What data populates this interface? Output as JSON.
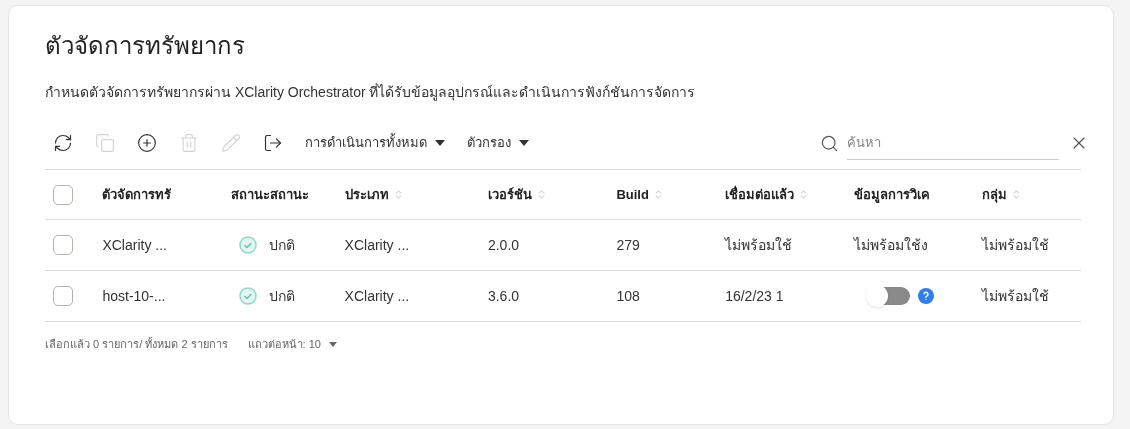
{
  "title": "ตัวจัดการทรัพยากร",
  "description": "กำหนดตัวจัดการทรัพยากรผ่าน XClarity Orchestrator ที่ได้รับข้อมูลอุปกรณ์และดำเนินการฟังก์ชันการจัดการ",
  "toolbar": {
    "icons": [
      {
        "kind": "refresh",
        "disabled": false
      },
      {
        "kind": "copy",
        "disabled": true
      },
      {
        "kind": "add",
        "disabled": false
      },
      {
        "kind": "delete",
        "disabled": true
      },
      {
        "kind": "edit",
        "disabled": true
      },
      {
        "kind": "export",
        "disabled": false
      }
    ],
    "menus": [
      "การดำเนินการทั้งหมด",
      "ตัวกรอง"
    ],
    "search": {
      "placeholder": "ค้นหา"
    }
  },
  "table": {
    "select_all": {
      "checked": false
    },
    "columns": [
      {
        "label": "ตัวจัดการทรั",
        "sortable": false
      },
      {
        "label": "สถานะสถานะ",
        "sortable": false
      },
      {
        "label": "ประเภท",
        "sortable": true
      },
      {
        "label": "เวอร์ชัน",
        "sortable": true
      },
      {
        "label": "Build",
        "sortable": true
      },
      {
        "label": "เชื่อมต่อแล้ว",
        "sortable": true
      },
      {
        "label": "ข้อมูลการวิเค",
        "sortable": false
      },
      {
        "label": "กลุ่ม",
        "sortable": true
      }
    ],
    "rows": [
      {
        "checked": false,
        "cells": [
          {
            "kind": "text",
            "text": "XClarity ..."
          },
          {
            "kind": "status",
            "text": "ปกติ"
          },
          {
            "kind": "text",
            "text": "XClarity ..."
          },
          {
            "kind": "text",
            "text": "2.0.0"
          },
          {
            "kind": "text",
            "text": "279"
          },
          {
            "kind": "text",
            "text": "ไม่พร้อมใช้"
          },
          {
            "kind": "text",
            "text": "ไม่พร้อมใช้ง"
          },
          {
            "kind": "text",
            "text": "ไม่พร้อมใช้"
          }
        ]
      },
      {
        "checked": false,
        "cells": [
          {
            "kind": "text",
            "text": "host-10-..."
          },
          {
            "kind": "status",
            "text": "ปกติ"
          },
          {
            "kind": "text",
            "text": "XClarity ..."
          },
          {
            "kind": "text",
            "text": "3.6.0"
          },
          {
            "kind": "text",
            "text": "108"
          },
          {
            "kind": "text",
            "text": "16/2/23 1"
          },
          {
            "kind": "toggle",
            "on": false
          },
          {
            "kind": "text",
            "text": "ไม่พร้อมใช้"
          }
        ]
      }
    ]
  },
  "footer": {
    "summary": "เลือกแล้ว 0 รายการ/ ทั้งหมด 2 รายการ",
    "per_page": "แถวต่อหน้า: 10"
  }
}
